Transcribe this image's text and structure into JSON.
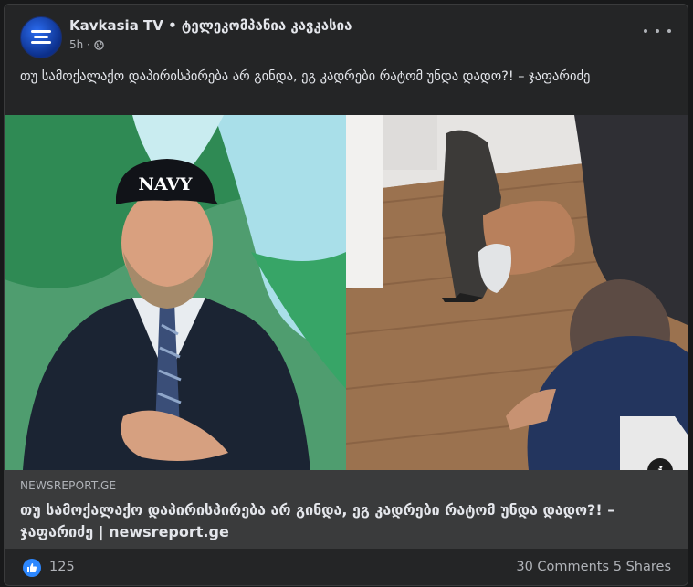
{
  "post": {
    "page_name": "Kavkasia TV • ტელეკომპანია კავკასია",
    "time": "5h ·",
    "privacy_icon": "globe-icon",
    "text": "თუ სამოქალაქო დაპირისპირება არ გინდა, ეგ კადრები რატომ უნდა დადო?! – ჯაფარიძე"
  },
  "image": {
    "cap_text": "NAVY"
  },
  "link_preview": {
    "domain": "NEWSREPORT.GE",
    "title": "თუ სამოქალაქო დაპირისპირება არ გინდა, ეგ კადრები რატომ უნდა დადო?! – ჯაფარიძე | newsreport.ge"
  },
  "reactions": {
    "like_count": "125",
    "comments": "30 Comments",
    "shares": "5 Shares"
  },
  "colors": {
    "background": "#18191a",
    "card": "#242526",
    "link_box": "#3a3b3c",
    "accent": "#2d88ff"
  }
}
